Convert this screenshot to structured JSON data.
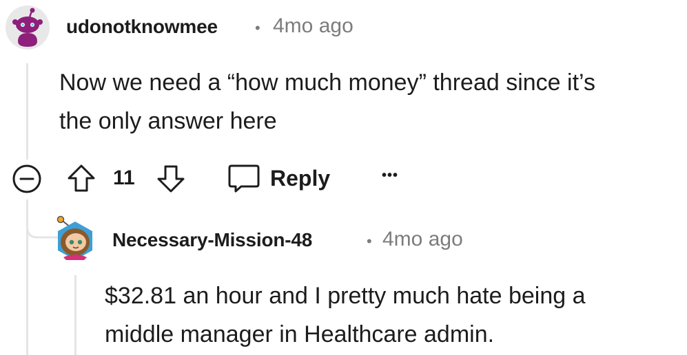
{
  "comment": {
    "username": "udonotknowmee",
    "timestamp": "4mo ago",
    "body_line1": "Now we need a “how much money” thread since it’s",
    "body_line2": "the only answer here",
    "votes": "11",
    "reply_label": "Reply",
    "more_label": "•••"
  },
  "reply": {
    "username": "Necessary-Mission-48",
    "timestamp": "4mo ago",
    "body_line1": "$32.81 an hour and I pretty much hate being a",
    "body_line2": "middle manager in Healthcare admin."
  },
  "separator": "•",
  "colors": {
    "text": "#1c1c1c",
    "meta": "#7c7c7c",
    "thread_line": "#e5e5e5",
    "avatar1_bg": "#e8e8e8",
    "avatar1_snoo": "#8e1f7a"
  }
}
